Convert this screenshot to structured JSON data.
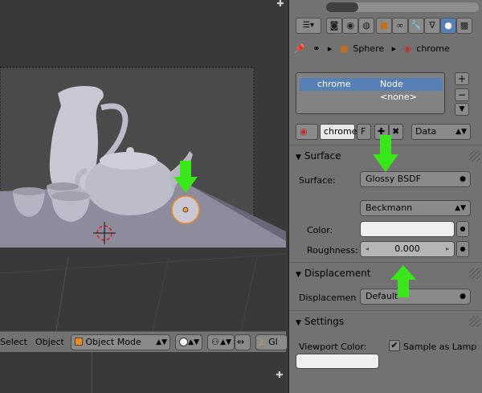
{
  "viewport": {
    "toolbar": {
      "menu_select": "Select",
      "menu_object": "Object",
      "mode": "Object Mode",
      "trailing_label": "Gl"
    }
  },
  "properties": {
    "breadcrumb": {
      "object": "Sphere",
      "material": "chrome"
    },
    "material_slots": [
      {
        "name": "chrome",
        "node": "Node <none>"
      }
    ],
    "datablock": {
      "name": "chrome",
      "fake_user": "F",
      "link": "Data"
    },
    "surface": {
      "title": "Surface",
      "surface_label": "Surface:",
      "surface_value": "Glossy BSDF",
      "distribution_value": "Beckmann",
      "color_label": "Color:",
      "roughness_label": "Roughness:",
      "roughness_value": "0.000"
    },
    "displacement": {
      "title": "Displacement",
      "label": "Displacemen",
      "value": "Default"
    },
    "settings": {
      "title": "Settings",
      "viewport_color_label": "Viewport Color:",
      "sample_as_lamp_label": "Sample as Lamp",
      "sample_as_lamp_checked": true
    }
  },
  "colors": {
    "viewport_bg": "#393939",
    "panel_bg": "#727272",
    "selection_blue": "#5780b6",
    "annotation_green": "#39e61a",
    "object_outline": "#f08a24"
  },
  "icons": [
    "plus-icon",
    "pin-icon",
    "object-icon",
    "material-icon",
    "scene-icon",
    "world-icon",
    "render-icon",
    "constraint-icon",
    "modifier-icon",
    "data-icon",
    "texture-icon",
    "particle-icon",
    "physics-icon",
    "cursor-icon"
  ]
}
